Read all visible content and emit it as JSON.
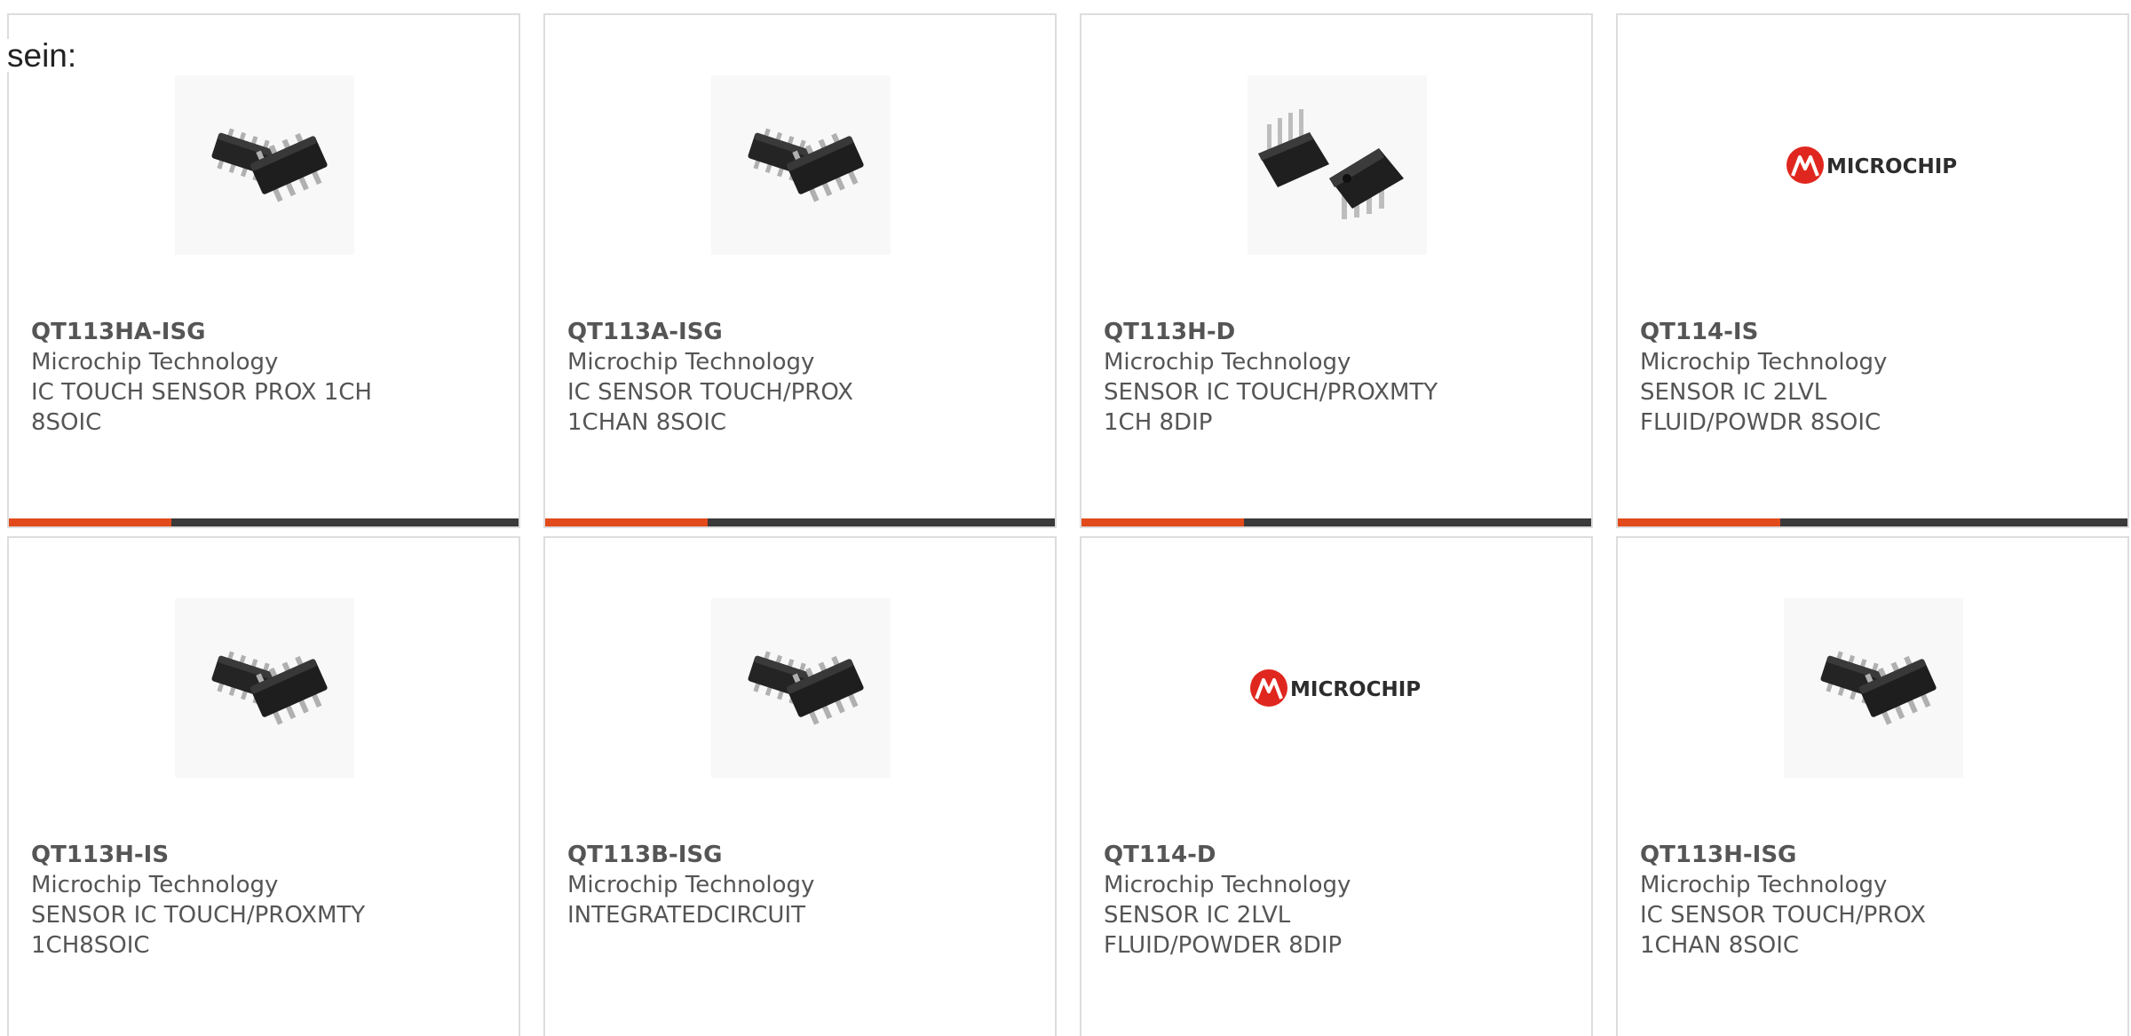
{
  "intro_text": "sein:",
  "brand": {
    "accent_color": "#e24a1b",
    "bar_color": "#3a3a3a",
    "logo_text": "MICROCHIP"
  },
  "products": [
    {
      "part": "QT113HA-ISG",
      "manufacturer": "Microchip Technology",
      "description": "IC TOUCH SENSOR PROX 1CH 8SOIC",
      "image": "soic-8-package-icon"
    },
    {
      "part": "QT113A-ISG",
      "manufacturer": "Microchip Technology",
      "description": "IC SENSOR TOUCH/PROX 1CHAN 8SOIC",
      "image": "soic-8-package-icon"
    },
    {
      "part": "QT113H-D",
      "manufacturer": "Microchip Technology",
      "description": "SENSOR IC TOUCH/PROXMTY 1CH 8DIP",
      "image": "dip-8-package-icon"
    },
    {
      "part": "QT114-IS",
      "manufacturer": "Microchip Technology",
      "description": "SENSOR IC 2LVL FLUID/POWDR 8SOIC",
      "image": "microchip-logo-icon"
    },
    {
      "part": "QT113H-IS",
      "manufacturer": "Microchip Technology",
      "description": "SENSOR IC TOUCH/PROXMTY 1CH8SOIC",
      "image": "soic-8-package-icon"
    },
    {
      "part": "QT113B-ISG",
      "manufacturer": "Microchip Technology",
      "description": "INTEGRATEDCIRCUIT",
      "image": "soic-8-package-icon"
    },
    {
      "part": "QT114-D",
      "manufacturer": "Microchip Technology",
      "description": "SENSOR IC 2LVL FLUID/POWDER 8DIP",
      "image": "microchip-logo-icon"
    },
    {
      "part": "QT113H-ISG",
      "manufacturer": "Microchip Technology",
      "description": "IC SENSOR TOUCH/PROX 1CHAN 8SOIC",
      "image": "soic-8-package-icon"
    }
  ]
}
